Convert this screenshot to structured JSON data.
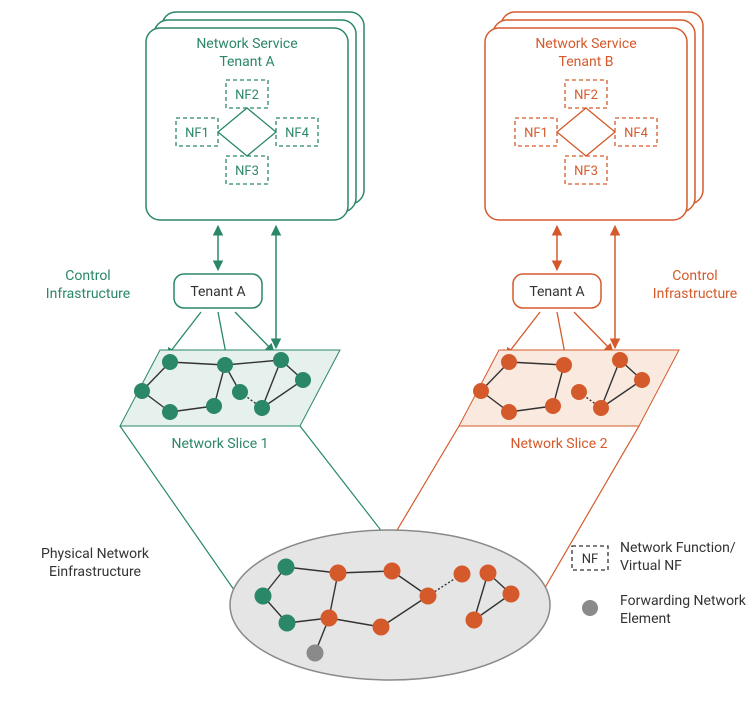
{
  "colors": {
    "green": "#2a8767",
    "greenFill": "#e6f0ec",
    "orange": "#d55a2b",
    "orangeFill": "#f9e9de",
    "gray": "#8a8a8a",
    "grayFill": "#e5e5e5",
    "black": "#333333"
  },
  "tenantA": {
    "title1": "Network Service",
    "title2": "Tenant A",
    "nf1": "NF1",
    "nf2": "NF2",
    "nf3": "NF3",
    "nf4": "NF4",
    "controlLabel1": "Control",
    "controlLabel2": "Infrastructure",
    "tenantLabel": "Tenant A",
    "sliceLabel": "Network Slice 1"
  },
  "tenantB": {
    "title1": "Network Service",
    "title2": "Tenant B",
    "nf1": "NF1",
    "nf2": "NF2",
    "nf3": "NF3",
    "nf4": "NF4",
    "controlLabel1": "Control",
    "controlLabel2": "Infrastructure",
    "tenantLabel": "Tenant A",
    "sliceLabel": "Network Slice 2"
  },
  "physical": {
    "label1": "Physical Network",
    "label2": "Einfrastructure"
  },
  "legend": {
    "nfBox": "NF",
    "nfLine1": "Network Function/",
    "nfLine2": "Virtual NF",
    "nodeLine1": "Forwarding Network",
    "nodeLine2": "Element"
  }
}
